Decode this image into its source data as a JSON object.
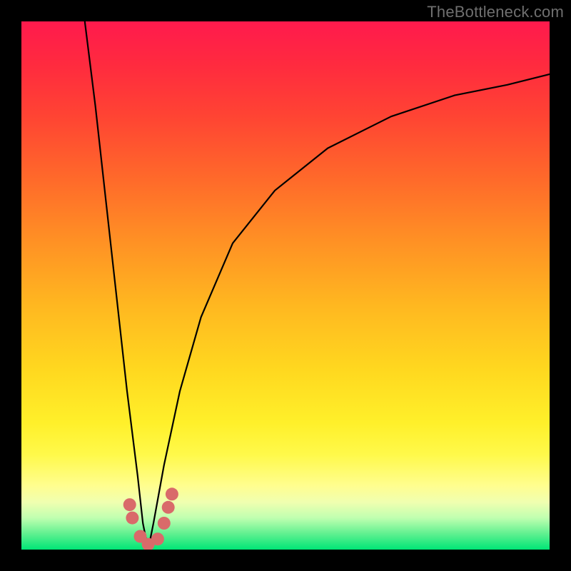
{
  "watermark": "TheBottleneck.com",
  "colors": {
    "frame": "#000000",
    "marker": "#d96a6a",
    "curve": "#000000",
    "gradient_top": "#ff1a4d",
    "gradient_bottom": "#00e676"
  },
  "chart_data": {
    "type": "line",
    "title": "",
    "xlabel": "",
    "ylabel": "",
    "xlim": [
      0,
      100
    ],
    "ylim": [
      0,
      100
    ],
    "grid": false,
    "legend": false,
    "note": "Axes are implicit (no ticks shown); values are estimated from pixel positions. Two curves descend to a shared minimum near x≈24, y≈0, with scattered markers near the trough.",
    "series": [
      {
        "name": "left-branch",
        "x": [
          12,
          14,
          16,
          18,
          20,
          22,
          23,
          24
        ],
        "values": [
          100,
          84,
          66,
          48,
          30,
          14,
          5,
          0
        ]
      },
      {
        "name": "right-branch",
        "x": [
          24,
          25,
          27,
          30,
          34,
          40,
          48,
          58,
          70,
          82,
          92,
          100
        ],
        "values": [
          0,
          5,
          16,
          30,
          44,
          58,
          68,
          76,
          82,
          86,
          88,
          90
        ]
      }
    ],
    "markers": [
      {
        "x": 20.5,
        "y": 8.5
      },
      {
        "x": 21.0,
        "y": 6.0
      },
      {
        "x": 22.5,
        "y": 2.5
      },
      {
        "x": 24.0,
        "y": 1.0
      },
      {
        "x": 25.8,
        "y": 2.0
      },
      {
        "x": 27.0,
        "y": 5.0
      },
      {
        "x": 27.8,
        "y": 8.0
      },
      {
        "x": 28.5,
        "y": 10.5
      }
    ]
  }
}
